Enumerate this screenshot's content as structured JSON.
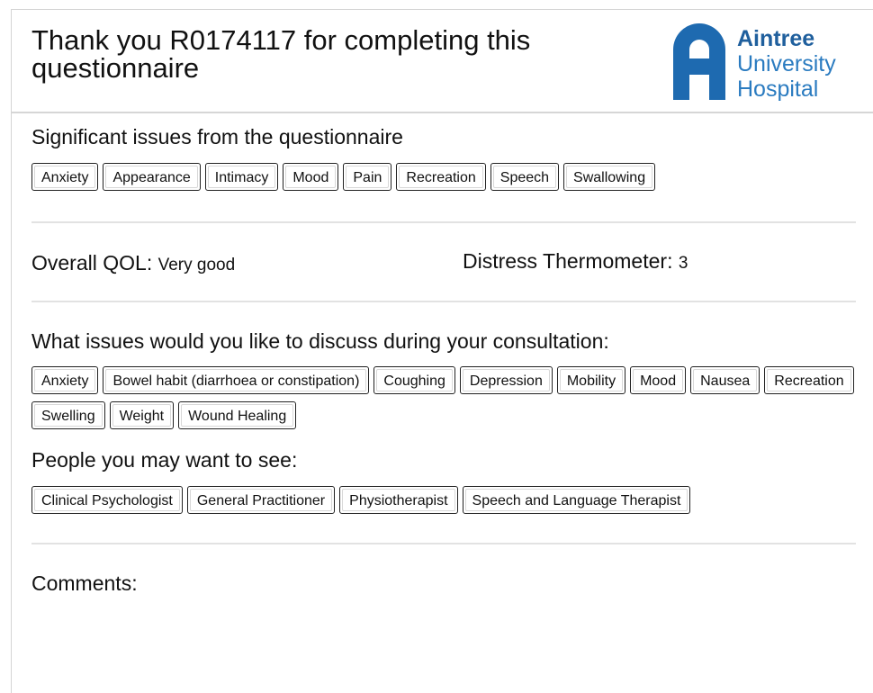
{
  "header": {
    "title": "Thank you R0174117 for completing this questionnaire",
    "logo": {
      "line1": "Aintree",
      "line2": "University",
      "line3": "Hospital",
      "icon": "aintree-logo-icon",
      "color": "#1e6ab0"
    }
  },
  "significant": {
    "title": "Significant issues from the questionnaire",
    "tags": [
      "Anxiety",
      "Appearance",
      "Intimacy",
      "Mood",
      "Pain",
      "Recreation",
      "Speech",
      "Swallowing"
    ]
  },
  "scores": {
    "qol_label": "Overall QOL:",
    "qol_value": "Very good",
    "distress_label": "Distress Thermometer:",
    "distress_value": "3"
  },
  "discuss": {
    "title": "What issues would you like to discuss during your consultation:",
    "tags": [
      "Anxiety",
      "Bowel habit (diarrhoea or constipation)",
      "Coughing",
      "Depression",
      "Mobility",
      "Mood",
      "Nausea",
      "Recreation",
      "Swelling",
      "Weight",
      "Wound Healing"
    ]
  },
  "people": {
    "title": "People you may want to see:",
    "tags": [
      "Clinical Psychologist",
      "General Practitioner",
      "Physiotherapist",
      "Speech and Language Therapist"
    ]
  },
  "comments": {
    "label": "Comments:"
  }
}
